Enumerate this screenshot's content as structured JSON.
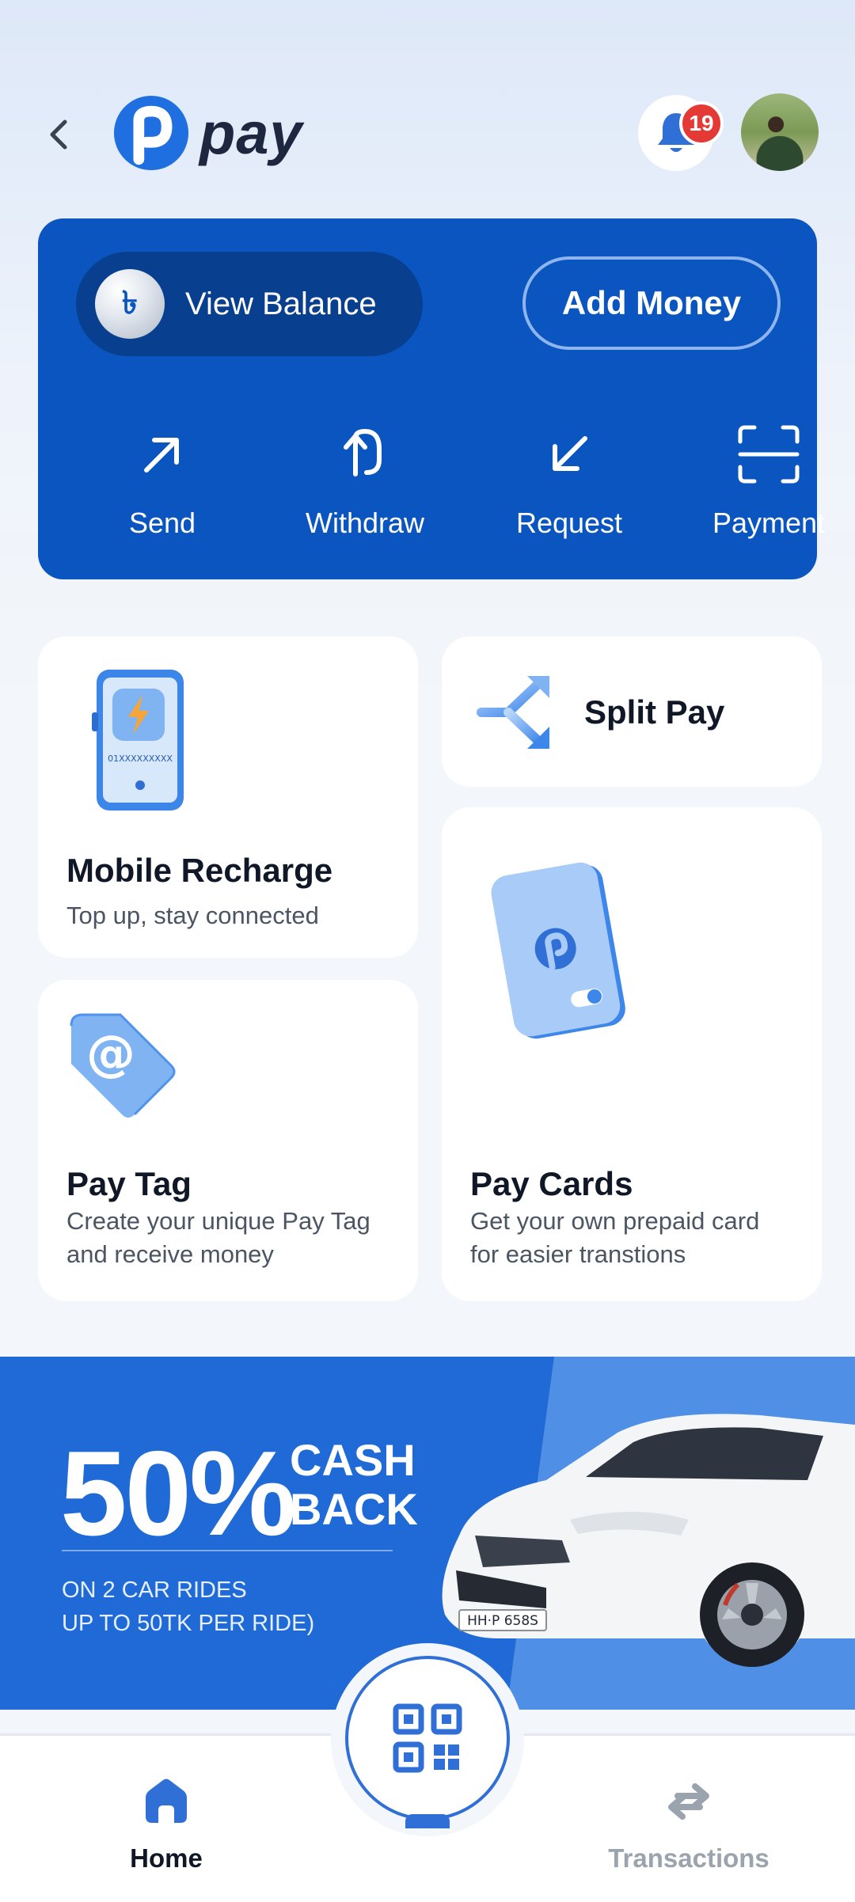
{
  "header": {
    "logo_text": "pay",
    "notification_count": "19"
  },
  "balance_card": {
    "currency_symbol": "৳",
    "view_balance_label": "View Balance",
    "add_money_label": "Add Money",
    "actions": [
      {
        "label": "Send",
        "icon": "arrow-up-right-icon"
      },
      {
        "label": "Withdraw",
        "icon": "withdraw-icon"
      },
      {
        "label": "Request",
        "icon": "arrow-down-left-icon"
      },
      {
        "label": "Payment",
        "icon": "scan-icon"
      }
    ]
  },
  "cards": {
    "mobile_recharge": {
      "title": "Mobile Recharge",
      "subtitle": "Top up, stay connected",
      "phone_number": "01XXXXXXXXX"
    },
    "split_pay": {
      "title": "Split Pay"
    },
    "pay_tag": {
      "title": "Pay Tag",
      "subtitle_line1": "Create your unique Pay Tag",
      "subtitle_line2": "and receive money"
    },
    "pay_cards": {
      "title": "Pay Cards",
      "subtitle_line1": "Get your own prepaid card",
      "subtitle_line2": "for easier transtions"
    }
  },
  "promo": {
    "percent": "50%",
    "cash_line1": "CASH",
    "cash_line2": "BACK",
    "detail_line1": "ON 2 CAR RIDES",
    "detail_line2": "UP TO 50TK PER RIDE)",
    "plate": "HH·P 658S"
  },
  "bottom_nav": {
    "home_label": "Home",
    "transactions_label": "Transactions"
  },
  "colors": {
    "primary": "#0a55c0",
    "primary_dark": "#083f8f",
    "promo_blue": "#1f6ad6",
    "badge_red": "#e53935",
    "inactive_gray": "#9aa3ae"
  }
}
